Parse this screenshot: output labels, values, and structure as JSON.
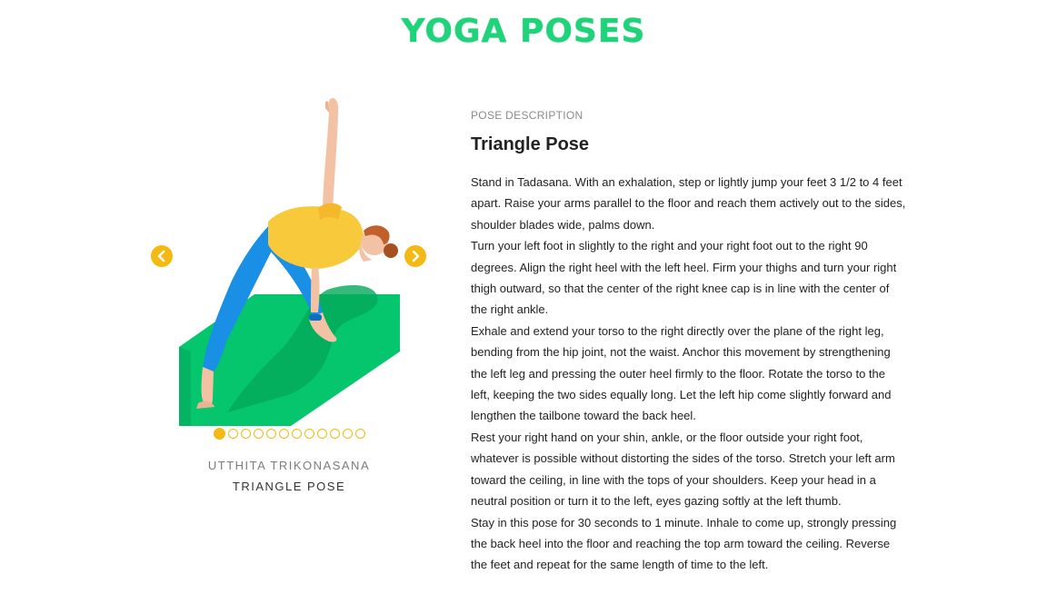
{
  "header": {
    "title": "Yoga Poses"
  },
  "carousel": {
    "prev_icon": "chevron-left-icon",
    "next_icon": "chevron-right-icon",
    "accent_color": "#f4b912",
    "slide_count": 12,
    "active_index": 0,
    "sanskrit_name": "Utthita Trikonasana",
    "english_name": "Triangle Pose"
  },
  "description": {
    "label": "Pose Description",
    "title": "Triangle Pose",
    "paragraphs": [
      "Stand in Tadasana. With an exhalation, step or lightly jump your feet 3 1/2 to 4 feet apart. Raise your arms parallel to the floor and reach them actively out to the sides, shoulder blades wide, palms down.",
      "Turn your left foot in slightly to the right and your right foot out to the right 90 degrees. Align the right heel with the left heel. Firm your thighs and turn your right thigh outward, so that the center of the right knee cap is in line with the center of the right ankle.",
      "Exhale and extend your torso to the right directly over the plane of the right leg, bending from the hip joint, not the waist. Anchor this movement by strengthening the left leg and pressing the outer heel firmly to the floor. Rotate the torso to the left, keeping the two sides equally long. Let the left hip come slightly forward and lengthen the tailbone toward the back heel.",
      "Rest your right hand on your shin, ankle, or the floor outside your right foot, whatever is possible without distorting the sides of the torso. Stretch your left arm toward the ceiling, in line with the tops of your shoulders. Keep your head in a neutral position or turn it to the left, eyes gazing softly at the left thumb.",
      "Stay in this pose for 30 seconds to 1 minute. Inhale to come up, strongly pressing the back heel into the floor and reaching the top arm toward the ceiling. Reverse the feet and repeat for the same length of time to the left."
    ]
  },
  "colors": {
    "brand_green": "#1fd37a",
    "mat_green": "#05c66c",
    "shirt_yellow": "#f8c93a",
    "pants_blue": "#1a8fe6"
  }
}
